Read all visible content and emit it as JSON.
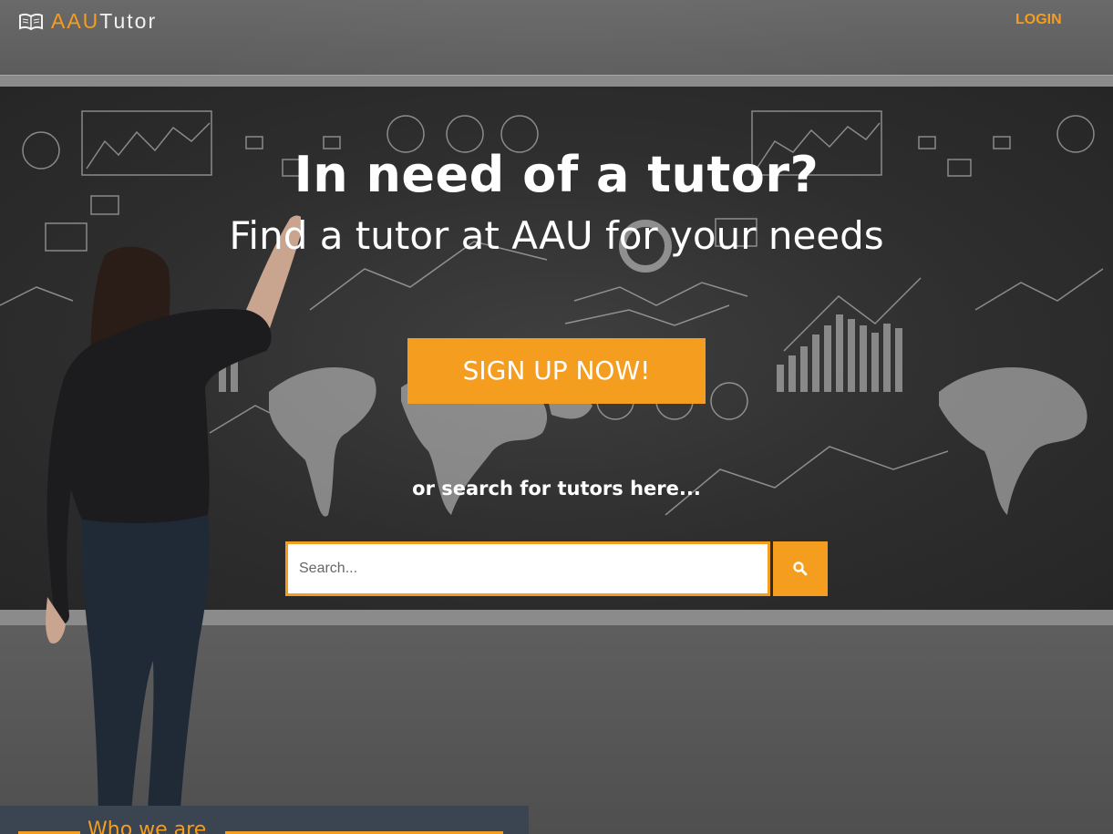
{
  "nav": {
    "brand_part1": "AAU",
    "brand_part2": "Tutor",
    "login_label": "LOGIN",
    "brand_icon": "open-book-icon"
  },
  "hero": {
    "title": "In need of a tutor?",
    "subtitle": "Find a tutor at AAU for your needs",
    "signup_label": "SIGN UP NOW!",
    "or_search_text": "or search for tutors here...",
    "search_placeholder": "Search...",
    "search_icon": "search-icon"
  },
  "about": {
    "heading": "Who we are"
  },
  "colors": {
    "accent": "#f49d1e",
    "panel": "#3b4552"
  }
}
